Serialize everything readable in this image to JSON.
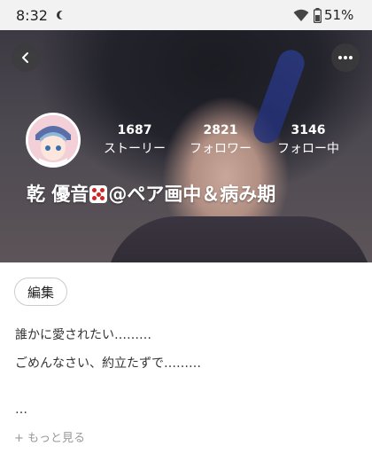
{
  "status_bar": {
    "time": "8:32",
    "battery": "51%"
  },
  "profile": {
    "name_part1": "乾 優音",
    "name_emoji": "dice-emoji",
    "name_part2": "@ペア画中＆病み期",
    "stats": [
      {
        "count": "1687",
        "label": "ストーリー"
      },
      {
        "count": "2821",
        "label": "フォロワー"
      },
      {
        "count": "3146",
        "label": "フォロー中"
      }
    ],
    "edit_label": "編集",
    "bio_lines": [
      "誰かに愛されたい………",
      "ごめんなさい、約立たずで………",
      "…"
    ],
    "show_more": "+ もっと見る"
  },
  "colors": {
    "accent": "#ffffff",
    "muted_text": "#999999",
    "status_bar_bg": "#f2f2f2"
  }
}
